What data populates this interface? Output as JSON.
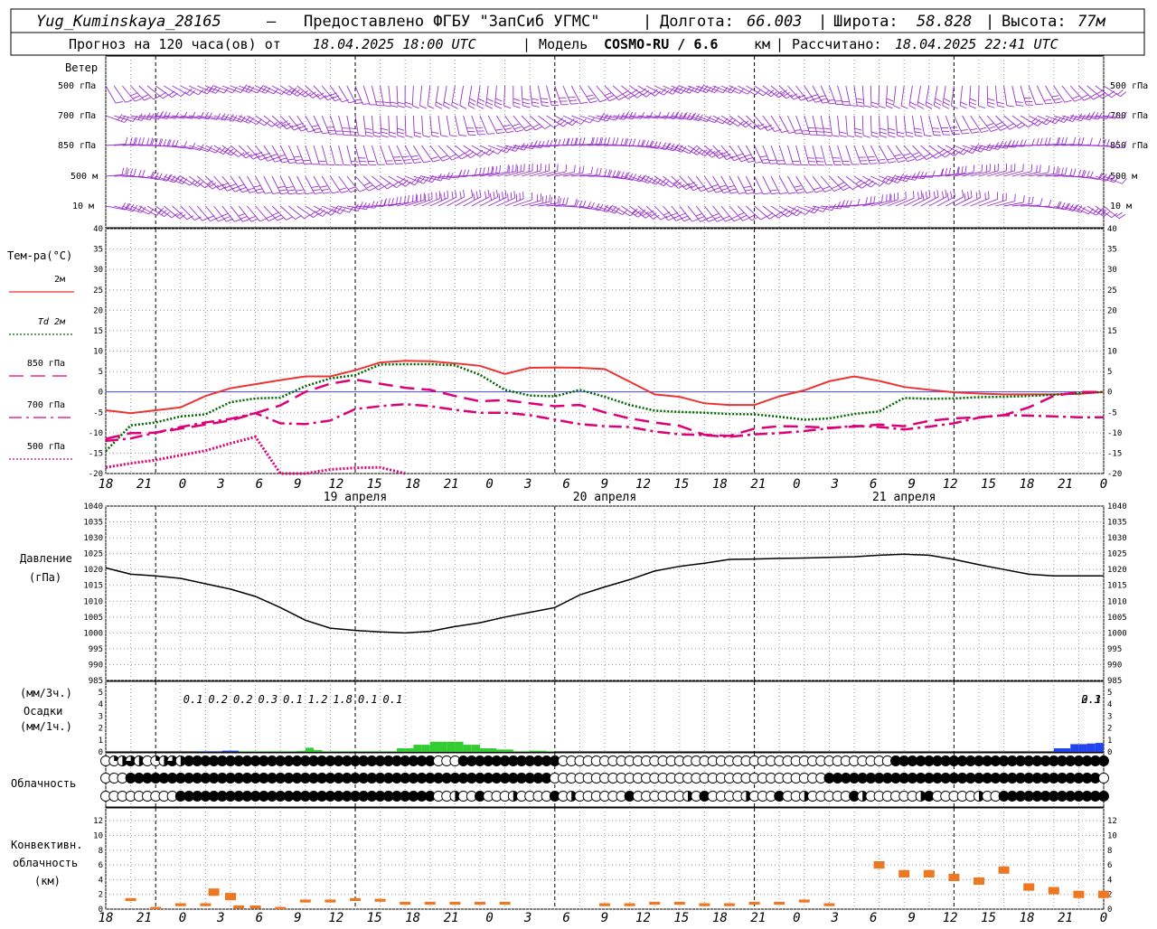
{
  "header": {
    "station": "Yug_Kuminskaya_28165",
    "provider": "Предоставлено ФГБУ \"ЗапСиб УГМС\"",
    "lon_label": "Долгота:",
    "lon_value": "66.003",
    "lat_label": "Широта:",
    "lat_value": "58.828",
    "alt_label": "Высота:",
    "alt_value": "77м",
    "forecast_label": "Прогноз на 120 часа(ов) от",
    "forecast_start": "18.04.2025 18:00 UTC",
    "model_label": "| Модель",
    "model_name": "COSMO-RU / 6.6",
    "model_unit": "км",
    "computed_label": "| Рассчитано:",
    "computed_time": "18.04.2025 22:41 UTC"
  },
  "colors": {
    "wind": "#9933cc",
    "t2m": "#ee3333",
    "td2m": "#006600",
    "t850": "#dd0077",
    "t700": "#dd0077",
    "t500": "#dd0077",
    "pressure": "#000000",
    "precip_green": "#33cc33",
    "precip_blue": "#2244ee",
    "convective": "#ee7722",
    "zero_line": "#4444ff"
  },
  "wind_panel": {
    "title": "Ветер",
    "levels": [
      "500 гПа",
      "700 гПа",
      "850 гПа",
      "500 м",
      "10 м"
    ]
  },
  "temp_panel": {
    "title": "Тем-ра(°C)",
    "legend": [
      {
        "label": "2м",
        "style": "solid"
      },
      {
        "label": "Td 2м",
        "style": "dotted"
      },
      {
        "label": "850 гПа",
        "style": "dash"
      },
      {
        "label": "700 гПа",
        "style": "dashdot"
      },
      {
        "label": "500 гПа",
        "style": "dot"
      }
    ]
  },
  "pressure_panel": {
    "title_1": "Давление",
    "title_2": "(гПа)"
  },
  "precip_panel": {
    "title_1": "(мм/3ч.)",
    "title_2": "Осадки",
    "title_3": "(мм/1ч.)",
    "labels": [
      "0.1",
      "0.2",
      "0.2",
      "0.3",
      "0.1",
      "1.2",
      "1.8",
      "0.1",
      "0.1",
      "0.3",
      "2.1"
    ]
  },
  "cloud_panel": {
    "title": "Облачность"
  },
  "conv_panel": {
    "title_1": "Конвективн.",
    "title_2": "облачность",
    "title_3": "(км)"
  },
  "x_axis": {
    "hour_labels": [
      "18",
      "21",
      "0",
      "3",
      "6",
      "9",
      "12",
      "15",
      "18",
      "21",
      "0",
      "3",
      "6",
      "9",
      "12",
      "15",
      "18",
      "21",
      "0",
      "3",
      "6",
      "9",
      "12",
      "15",
      "18",
      "21",
      "0"
    ],
    "dates": [
      "19 апреля",
      "20 апреля",
      "21 апреля"
    ]
  },
  "chart_data": [
    {
      "type": "line",
      "title": "Тем-ра(°C)",
      "x_unit": "hours from 18.04.2025 18:00 UTC",
      "ylim": [
        -20,
        40
      ],
      "yticks": [
        -20,
        -15,
        -10,
        -5,
        0,
        5,
        10,
        15,
        20,
        25,
        30,
        35,
        40
      ],
      "series": [
        {
          "name": "2м",
          "x": [
            0,
            3,
            6,
            9,
            12,
            15,
            18,
            21,
            24,
            27,
            30,
            33,
            36,
            39,
            42,
            45,
            48,
            51,
            54,
            57,
            60,
            63,
            66,
            69,
            72,
            75,
            78,
            81,
            84,
            87,
            90,
            93,
            96,
            99,
            102,
            105,
            108,
            111,
            114,
            117,
            120
          ],
          "values": [
            -4.5,
            -5.2,
            -4.5,
            -3.8,
            -1,
            0.9,
            1.9,
            2.9,
            3.8,
            3.8,
            5.3,
            7.2,
            7.6,
            7.5,
            7,
            6.4,
            4.4,
            5.9,
            6,
            5.9,
            5.6,
            2.5,
            -0.6,
            -1.2,
            -2.8,
            -3.2,
            -3.2,
            -1.1,
            0.4,
            2.6,
            3.8,
            2.7,
            1.2,
            0.5,
            -0.1,
            -0.4,
            -0.6,
            -0.6,
            -0.6,
            -0.5,
            0
          ]
        },
        {
          "name": "Td 2м",
          "x": [
            0,
            3,
            6,
            9,
            12,
            15,
            18,
            21,
            24,
            27,
            30,
            33,
            36,
            39,
            42,
            45,
            48,
            51,
            54,
            57,
            60,
            63,
            66,
            69,
            72,
            75,
            78,
            81,
            84,
            87,
            90,
            93,
            96,
            99,
            102,
            105,
            108,
            111,
            114,
            117,
            120
          ],
          "values": [
            -14.5,
            -8.2,
            -7.5,
            -6,
            -5.5,
            -2.5,
            -1.6,
            -1.4,
            1.4,
            3.3,
            4.1,
            6.7,
            6.8,
            6.8,
            6.5,
            4.2,
            0.5,
            -0.9,
            -1.1,
            0.5,
            -1.2,
            -3.2,
            -4.6,
            -4.9,
            -5.1,
            -5.4,
            -5.5,
            -6.1,
            -6.8,
            -6.5,
            -5.4,
            -4.8,
            -1.5,
            -1.7,
            -1.6,
            -1.3,
            -1.2,
            -1,
            -0.7,
            -0.3,
            0
          ]
        },
        {
          "name": "850 гПа",
          "x": [
            0,
            3,
            6,
            9,
            12,
            15,
            18,
            21,
            24,
            27,
            30,
            33,
            36,
            39,
            42,
            45,
            48,
            51,
            54,
            57,
            60,
            63,
            66,
            69,
            72,
            75,
            78,
            81,
            84,
            87,
            90,
            93,
            96,
            99,
            102,
            105,
            108,
            111,
            114,
            117,
            120
          ],
          "values": [
            -11.5,
            -10.1,
            -10,
            -9,
            -8,
            -7,
            -5.2,
            -3.3,
            0,
            2,
            3,
            2,
            1,
            0.5,
            -1,
            -2.3,
            -2,
            -2.8,
            -3.5,
            -3.2,
            -5,
            -6.5,
            -7.5,
            -8.3,
            -10.5,
            -10.8,
            -9,
            -8.4,
            -8.5,
            -8.8,
            -8.5,
            -8,
            -8.4,
            -7.1,
            -6.5,
            -6.2,
            -5.7,
            -3.8,
            -1,
            0,
            0
          ]
        },
        {
          "name": "700 гПа",
          "x": [
            0,
            3,
            6,
            9,
            12,
            15,
            18,
            21,
            24,
            27,
            30,
            33,
            36,
            39,
            42,
            45,
            48,
            51,
            54,
            57,
            60,
            63,
            66,
            69,
            72,
            75,
            78,
            81,
            84,
            87,
            90,
            93,
            96,
            99,
            102,
            105,
            108,
            111,
            114,
            117,
            120
          ],
          "values": [
            -12,
            -11.4,
            -10,
            -8.6,
            -7.5,
            -6.6,
            -5.2,
            -7.7,
            -7.9,
            -7,
            -4.2,
            -3.5,
            -3,
            -3.5,
            -4.4,
            -5.1,
            -5.1,
            -5.7,
            -6.8,
            -7.9,
            -8.4,
            -8.6,
            -9.7,
            -10.4,
            -10.6,
            -11,
            -10.4,
            -10.1,
            -9.6,
            -8.9,
            -8.3,
            -8.6,
            -9.2,
            -8.5,
            -7.7,
            -6.3,
            -5.7,
            -5.8,
            -6,
            -6.2,
            -6.2
          ]
        },
        {
          "name": "500 гПа",
          "x": [
            0,
            3,
            6,
            9,
            12,
            15,
            18,
            21,
            24,
            27,
            30,
            33,
            36
          ],
          "values": [
            -18.5,
            -17.5,
            -16.7,
            -15.5,
            -14.4,
            -12.6,
            -11,
            -20,
            -20,
            -19,
            -18.6,
            -18.5,
            -20
          ]
        }
      ]
    },
    {
      "type": "line",
      "title": "Давление (гПа)",
      "ylim": [
        985,
        1040
      ],
      "yticks": [
        985,
        990,
        995,
        1000,
        1005,
        1010,
        1015,
        1020,
        1025,
        1030,
        1035,
        1040
      ],
      "series": [
        {
          "name": "Давление",
          "x": [
            0,
            3,
            6,
            9,
            12,
            15,
            18,
            21,
            24,
            27,
            30,
            33,
            36,
            39,
            42,
            45,
            48,
            51,
            54,
            57,
            60,
            63,
            66,
            69,
            72,
            75,
            78,
            81,
            84,
            87,
            90,
            93,
            96,
            99,
            102,
            105,
            108,
            111,
            114,
            117,
            120
          ],
          "values": [
            1020.5,
            1018.5,
            1018,
            1017.2,
            1015.5,
            1013.8,
            1011.5,
            1008,
            1004,
            1001.5,
            1000.8,
            1000.3,
            1000,
            1000.5,
            1002,
            1003.2,
            1005,
            1006.5,
            1008,
            1012,
            1014.5,
            1016.8,
            1019.5,
            1021,
            1022,
            1023.2,
            1023.3,
            1023.5,
            1023.6,
            1023.8,
            1024,
            1024.5,
            1024.8,
            1024.5,
            1023.2,
            1021.5,
            1020,
            1018.5,
            1018,
            1018,
            1018
          ]
        }
      ]
    },
    {
      "type": "bar",
      "title": "Осадки (мм/1ч.)",
      "ylim": [
        0,
        5
      ],
      "series": [
        {
          "name": "Осадки",
          "x": [
            12,
            13,
            14,
            15,
            16,
            17,
            18,
            19,
            20,
            21,
            22,
            23,
            24,
            25,
            26,
            27,
            28,
            29,
            30,
            31,
            32,
            33,
            34,
            35,
            36,
            37,
            38,
            39,
            40,
            41,
            42,
            43,
            44,
            45,
            46,
            47,
            48,
            49,
            50,
            51,
            52,
            53,
            54,
            115,
            116,
            117,
            118,
            119,
            120
          ],
          "values": [
            0.05,
            0.05,
            0.05,
            0.1,
            0.1,
            0.05,
            0.05,
            0.05,
            0.05,
            0.05,
            0.05,
            0.05,
            0.08,
            0.35,
            0.15,
            0.05,
            0.05,
            0.05,
            0.05,
            0.05,
            0.05,
            0.05,
            0.05,
            0.05,
            0.3,
            0.3,
            0.6,
            0.6,
            0.85,
            0.85,
            0.85,
            0.85,
            0.6,
            0.6,
            0.3,
            0.3,
            0.2,
            0.2,
            0.05,
            0.05,
            0.1,
            0.1,
            0.05,
            0.3,
            0.3,
            0.65,
            0.65,
            0.7,
            0.75
          ]
        }
      ]
    },
    {
      "type": "bar",
      "title": "Конвективн. облачность (км)",
      "ylim": [
        0,
        13
      ],
      "yticks": [
        0,
        2,
        4,
        6,
        8,
        10,
        12
      ],
      "series": [
        {
          "name": "Конвективн. облачность",
          "x": [
            3,
            6,
            9,
            12,
            13,
            15,
            16,
            18,
            21,
            24,
            27,
            30,
            33,
            36,
            39,
            42,
            45,
            48,
            51,
            54,
            57,
            60,
            63,
            66,
            69,
            72,
            75,
            78,
            81,
            84,
            87,
            90,
            93,
            96,
            99,
            102,
            105,
            108,
            111,
            114,
            117,
            120
          ],
          "values": [
            1.5,
            0.3,
            0.8,
            0.8,
            2.8,
            2.2,
            0.5,
            0.5,
            0.3,
            1.3,
            1.3,
            1.5,
            1.4,
            1.0,
            1.0,
            1.0,
            1.0,
            1.0,
            0,
            0,
            0,
            0.8,
            0.8,
            1.0,
            1.0,
            0.8,
            0.8,
            1.0,
            1.0,
            1.3,
            0.8,
            0,
            6.5,
            5.3,
            5.3,
            4.8,
            4.3,
            5.8,
            3.5,
            3.0,
            2.5,
            2.5
          ]
        }
      ]
    }
  ]
}
